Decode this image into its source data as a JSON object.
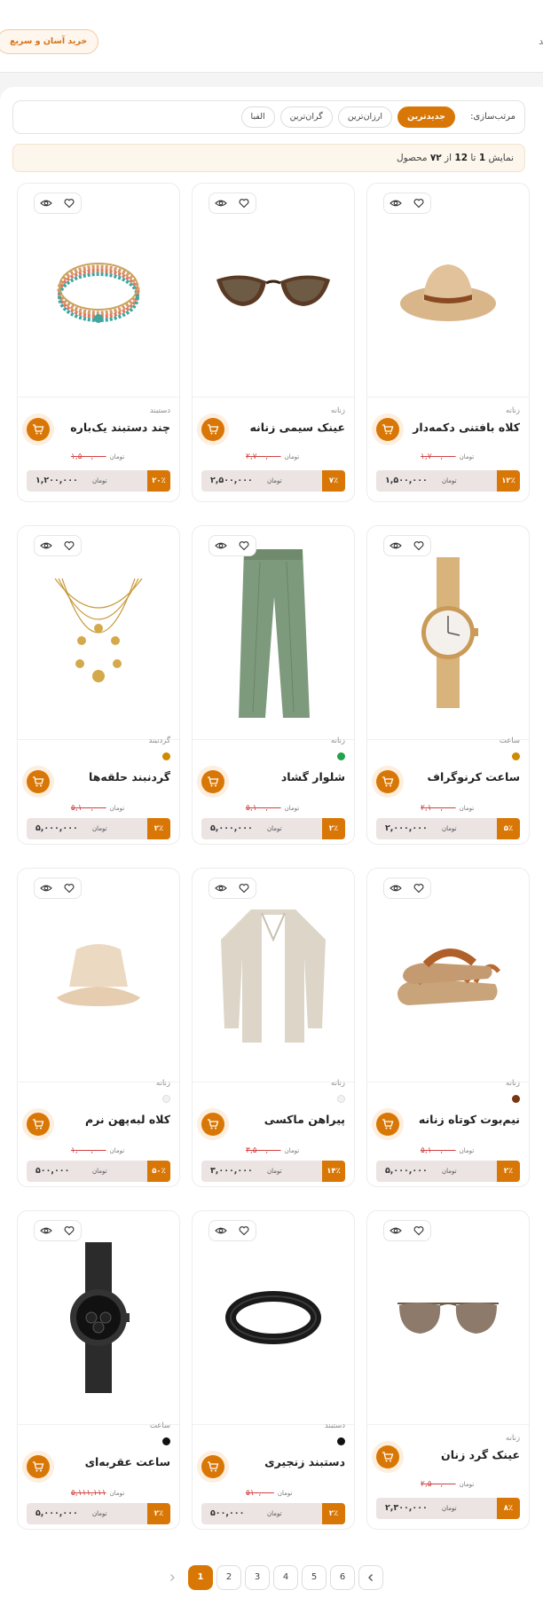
{
  "header": {
    "fragment": "ید",
    "promo": "خرید آسان و سریع"
  },
  "sort": {
    "label": "مرتب‌سازی:",
    "options": [
      "جدیدترین",
      "ارزان‌ترین",
      "گران‌ترین",
      "الفبا"
    ],
    "active": "جدیدترین"
  },
  "count": {
    "prefix": "نمایش",
    "from": "1",
    "to_word": "تا",
    "to": "12",
    "of_word": "از",
    "total": "۷۲",
    "suffix": "محصول"
  },
  "currency": "تومان",
  "colors": {
    "accent": "#d97706",
    "discount_bar": "#ece3e3",
    "old_price": "#d14343"
  },
  "products": [
    {
      "category": "زنانه",
      "name": "کلاه بافتنی دکمه‌دار",
      "old_price": "۱,۷۰۰,۰۰۰",
      "price": "۱,۵۰۰,۰۰۰",
      "discount": "۱۲٪",
      "dot": "",
      "image": "straw-hat"
    },
    {
      "category": "زنانه",
      "name": "عینک سیمی زنانه",
      "old_price": "۲,۷۰۰,۰۰۰",
      "price": "۲,۵۰۰,۰۰۰",
      "discount": "۷٪",
      "dot": "",
      "image": "cat-eye-sunglasses"
    },
    {
      "category": "دستبند",
      "name": "چند دستبند یک‌باره",
      "old_price": "۱,۵۰۰,۰۰۰",
      "price": "۱,۲۰۰,۰۰۰",
      "discount": "۲۰٪",
      "dot": "",
      "image": "beaded-bracelet"
    },
    {
      "category": "ساعت",
      "name": "ساعت کرنوگراف",
      "old_price": "۲,۱۰۰,۰۰۰",
      "price": "۲,۰۰۰,۰۰۰",
      "discount": "۵٪",
      "dot": "#cf8a00",
      "image": "gold-watch"
    },
    {
      "category": "زنانه",
      "name": "شلوار گشاد",
      "old_price": "۵,۱۰۰,۰۰۰",
      "price": "۵,۰۰۰,۰۰۰",
      "discount": "۲٪",
      "dot": "#22a24a",
      "image": "green-trousers"
    },
    {
      "category": "گردنبند",
      "name": "گردنبند حلقه‌ها",
      "old_price": "۵,۱۰۰,۰۰۰",
      "price": "۵,۰۰۰,۰۰۰",
      "discount": "۲٪",
      "dot": "#cf8a00",
      "image": "gold-necklace"
    },
    {
      "category": "زنانه",
      "name": "نیم‌بوت کوتاه زنانه",
      "old_price": "۵,۱۰۰,۰۰۰",
      "price": "۵,۰۰۰,۰۰۰",
      "discount": "۲٪",
      "dot": "#7a3512",
      "image": "sandals"
    },
    {
      "category": "زنانه",
      "name": "پیراهن ماکسی",
      "old_price": "۳,۵۰۰,۰۰۰",
      "price": "۳,۰۰۰,۰۰۰",
      "discount": "۱۴٪",
      "dot": "#f2f2f2",
      "image": "linen-shirt"
    },
    {
      "category": "زنانه",
      "name": "کلاه لبه‌پهن نرم",
      "old_price": "۱,۰۰۰,۰۰۰",
      "price": "۵۰۰,۰۰۰",
      "discount": "۵۰٪",
      "dot": "#f2f2f2",
      "image": "bucket-hat"
    },
    {
      "category": "زنانه",
      "name": "عینک گرد زنان",
      "old_price": "۲,۵۰۰,۰۰۰",
      "price": "۲,۳۰۰,۰۰۰",
      "discount": "۸٪",
      "dot": "",
      "image": "aviator-sunglasses"
    },
    {
      "category": "دستبند",
      "name": "دستبند زنجیری",
      "old_price": "۵۱۰,۰۰۰",
      "price": "۵۰۰,۰۰۰",
      "discount": "۲٪",
      "dot": "#111111",
      "image": "black-bracelet"
    },
    {
      "category": "ساعت",
      "name": "ساعت عقربه‌ای",
      "old_price": "۵,۱۱۱,۱۱۱",
      "price": "۵,۰۰۰,۰۰۰",
      "discount": "۲٪",
      "dot": "#111111",
      "image": "black-watch"
    }
  ],
  "pagination": {
    "pages": [
      "1",
      "2",
      "3",
      "4",
      "5",
      "6"
    ],
    "current": "1"
  }
}
